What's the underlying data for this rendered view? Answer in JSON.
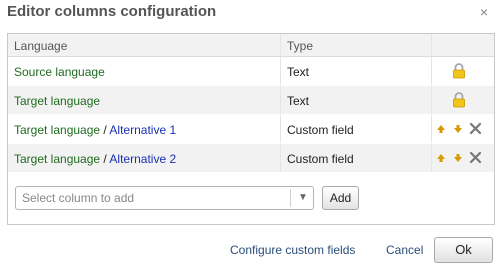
{
  "dialog": {
    "title": "Editor columns configuration",
    "close_symbol": "×"
  },
  "grid": {
    "columns": [
      "Language",
      "Type"
    ],
    "rows": [
      {
        "language": "Source language",
        "alternative": "",
        "type": "Text",
        "actions": [
          "lock-icon"
        ]
      },
      {
        "language": "Target language",
        "alternative": "",
        "type": "Text",
        "actions": [
          "lock-icon"
        ]
      },
      {
        "language": "Target language",
        "separator": " / ",
        "alternative": "Alternative 1",
        "type": "Custom field",
        "actions": [
          "move-up-icon",
          "move-down-icon",
          "remove-icon"
        ]
      },
      {
        "language": "Target language",
        "separator": " / ",
        "alternative": "Alternative 2",
        "type": "Custom field",
        "actions": [
          "move-up-icon",
          "move-down-icon",
          "remove-icon"
        ]
      }
    ]
  },
  "add_column": {
    "placeholder": "Select column to add",
    "button_label": "Add"
  },
  "footer": {
    "configure_label": "Configure custom fields",
    "cancel_label": "Cancel",
    "ok_label": "Ok"
  },
  "colors": {
    "language_text": "#1f6b1f",
    "alternative_text": "#1a2fb3",
    "link": "#2a4e7a",
    "lock": "#f0c419",
    "arrow": "#d99a00"
  }
}
